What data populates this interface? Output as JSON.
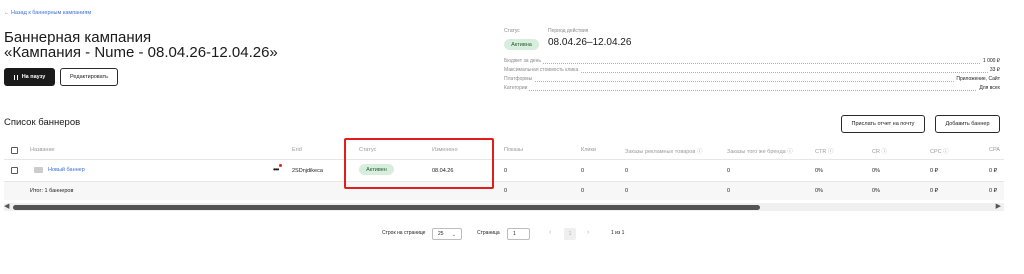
{
  "nav": {
    "back_link": "← Назад к баннерным кампаниям"
  },
  "header": {
    "title_line1": "Баннерная кампания",
    "title_line2": "«Кампания - Nume - 08.04.26-12.04.26»",
    "pause_button": "На паузу",
    "edit_button": "Редактировать"
  },
  "summary": {
    "status_label": "Статус",
    "status_value": "Активна",
    "period_label": "Период действия",
    "period_value": "08.04.26–12.04.26",
    "rows": [
      {
        "label": "Бюджет за день",
        "value": "1 000 ₽"
      },
      {
        "label": "Максимальная стоимость клика",
        "value": "33 ₽"
      },
      {
        "label": "Платформы",
        "value": "Приложение, Сайт"
      },
      {
        "label": "Категории",
        "value": "Для всех"
      }
    ]
  },
  "banners": {
    "title": "Список баннеров",
    "report_button": "Прислать отчет на почту",
    "add_button": "Добавить баннер",
    "columns": [
      "Название",
      "Erid",
      "Статус",
      "Изменено",
      "Показы",
      "Клики",
      "Заказы рекламных товаров ⓘ",
      "Заказы того же бренда ⓘ",
      "CTR ⓘ",
      "CR ⓘ",
      "CPC ⓘ",
      "CPA"
    ],
    "row": {
      "name": "Новый баннер",
      "erid": "2SDnjdikeca",
      "status": "Активен",
      "changed": "08.04.26",
      "shows": "0",
      "clicks": "0",
      "orders_ad": "0",
      "orders_brand": "0",
      "ctr": "0%",
      "cr": "0%",
      "cpc": "0 ₽",
      "cpa": "0 ₽"
    },
    "footer": {
      "total": "Итог: 1 баннеров",
      "shows": "0",
      "clicks": "0",
      "orders_ad": "0",
      "orders_brand": "0",
      "ctr": "0%",
      "cr": "0%",
      "cpc": "0 ₽",
      "cpa": "0 ₽"
    }
  },
  "pagination": {
    "rows_label": "Строк на странице",
    "rows_value": "25",
    "page_label": "Страница",
    "page_value": "1",
    "current_page": "1",
    "range": "1 из 1"
  },
  "colors": {
    "accent": "#3b6fd8",
    "status_bg": "#d8eedd",
    "status_text": "#1f5a30",
    "highlight": "#e11d1d"
  }
}
